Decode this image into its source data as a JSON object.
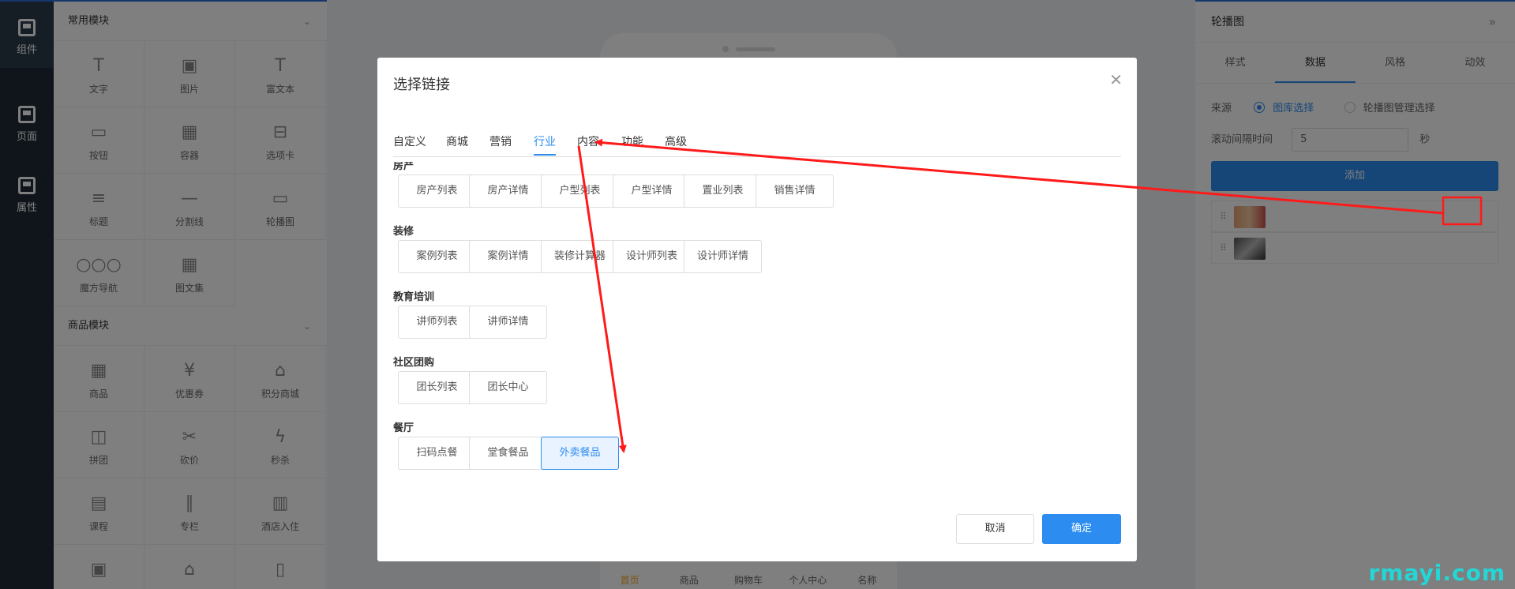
{
  "rail": {
    "items": [
      {
        "label": "组件",
        "icon": "component-icon",
        "active": true
      },
      {
        "label": "页面",
        "icon": "page-icon",
        "active": false
      },
      {
        "label": "属性",
        "icon": "property-icon",
        "active": false
      }
    ]
  },
  "panel": {
    "common": {
      "title": "常用模块",
      "items": [
        {
          "label": "文字",
          "icon": "T"
        },
        {
          "label": "图片",
          "icon": "▣"
        },
        {
          "label": "富文本",
          "icon": "T"
        },
        {
          "label": "按钮",
          "icon": "▭"
        },
        {
          "label": "容器",
          "icon": "▦"
        },
        {
          "label": "选项卡",
          "icon": "⊟"
        },
        {
          "label": "标题",
          "icon": "≡"
        },
        {
          "label": "分割线",
          "icon": "—"
        },
        {
          "label": "轮播图",
          "icon": "▭"
        },
        {
          "label": "魔方导航",
          "icon": "○○○"
        },
        {
          "label": "图文集",
          "icon": "▦"
        }
      ]
    },
    "goods": {
      "title": "商品模块",
      "items": [
        {
          "label": "商品",
          "icon": "▦"
        },
        {
          "label": "优惠券",
          "icon": "¥"
        },
        {
          "label": "积分商城",
          "icon": "⌂"
        },
        {
          "label": "拼团",
          "icon": "◫"
        },
        {
          "label": "砍价",
          "icon": "✂"
        },
        {
          "label": "秒杀",
          "icon": "ϟ"
        },
        {
          "label": "课程",
          "icon": "▤"
        },
        {
          "label": "专栏",
          "icon": "∥"
        },
        {
          "label": "酒店入住",
          "icon": "▥"
        },
        {
          "label": "",
          "icon": "▣"
        },
        {
          "label": "",
          "icon": "⌂"
        },
        {
          "label": "",
          "icon": "▯"
        }
      ]
    }
  },
  "phone": {
    "nav": [
      {
        "label": "首页",
        "on": true
      },
      {
        "label": "商品",
        "on": false
      },
      {
        "label": "购物车",
        "on": false
      },
      {
        "label": "个人中心",
        "on": false
      },
      {
        "label": "名称",
        "on": false
      }
    ]
  },
  "rpanel": {
    "title": "轮播图",
    "tabs": [
      {
        "label": "样式",
        "on": false
      },
      {
        "label": "数据",
        "on": true
      },
      {
        "label": "风格",
        "on": false
      },
      {
        "label": "动效",
        "on": false
      }
    ],
    "source_label": "来源",
    "source_opt1": "图库选择",
    "source_opt2": "轮播图管理选择",
    "interval_label": "滚动间隔时间",
    "interval_value": "5",
    "interval_unit": "秒",
    "add_label": "添加"
  },
  "modal": {
    "title": "选择链接",
    "tabs": [
      {
        "label": "自定义",
        "on": false
      },
      {
        "label": "商城",
        "on": false
      },
      {
        "label": "营销",
        "on": false
      },
      {
        "label": "行业",
        "on": true
      },
      {
        "label": "内容",
        "on": false
      },
      {
        "label": "功能",
        "on": false
      },
      {
        "label": "高级",
        "on": false
      }
    ],
    "categories": [
      {
        "name": "房产",
        "options": [
          {
            "label": "房产列表"
          },
          {
            "label": "房产详情"
          },
          {
            "label": "户型列表"
          },
          {
            "label": "户型详情"
          },
          {
            "label": "置业列表"
          },
          {
            "label": "销售详情"
          }
        ]
      },
      {
        "name": "装修",
        "options": [
          {
            "label": "案例列表"
          },
          {
            "label": "案例详情"
          },
          {
            "label": "装修计算器"
          },
          {
            "label": "设计师列表"
          },
          {
            "label": "设计师详情"
          }
        ]
      },
      {
        "name": "教育培训",
        "options": [
          {
            "label": "讲师列表"
          },
          {
            "label": "讲师详情"
          }
        ]
      },
      {
        "name": "社区团购",
        "options": [
          {
            "label": "团长列表"
          },
          {
            "label": "团长中心"
          }
        ]
      },
      {
        "name": "餐厅",
        "options": [
          {
            "label": "扫码点餐"
          },
          {
            "label": "堂食餐品"
          },
          {
            "label": "外卖餐品",
            "selected": true
          }
        ]
      }
    ],
    "cancel_label": "取消",
    "ok_label": "确定"
  },
  "watermark": "rmayi.com",
  "colors": {
    "accent": "#2d8cf0",
    "annotation": "#ff1a1a",
    "rail": "#1f2a36",
    "watermark": "#24d6d6"
  }
}
